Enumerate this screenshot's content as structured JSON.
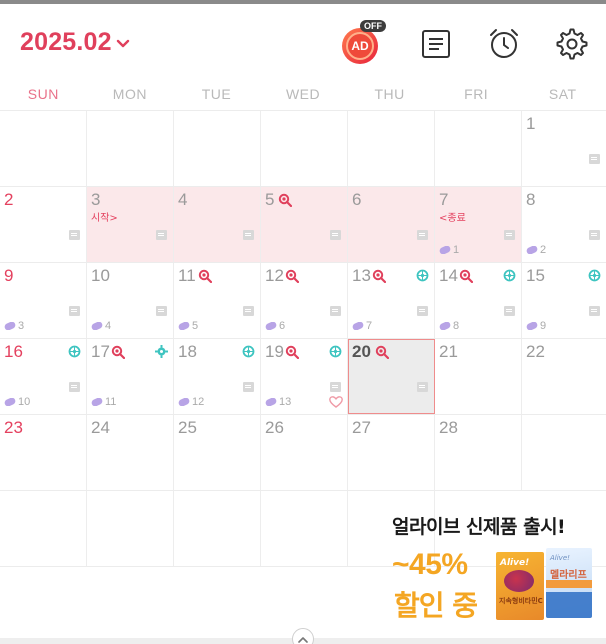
{
  "header": {
    "month": "2025.02",
    "ad_label": "AD",
    "ad_badge": "OFF"
  },
  "weekdays": [
    "SUN",
    "MON",
    "TUE",
    "WED",
    "THU",
    "FRI",
    "SAT"
  ],
  "calendar": {
    "today": "20",
    "period_start_label": "시작>",
    "period_end_label": "<종료",
    "dates": [
      "1",
      "2",
      "3",
      "4",
      "5",
      "6",
      "7",
      "8",
      "9",
      "10",
      "11",
      "12",
      "13",
      "14",
      "15",
      "16",
      "17",
      "18",
      "19",
      "20",
      "21",
      "22",
      "23",
      "24",
      "25",
      "26",
      "27",
      "28"
    ],
    "pill_counts": [
      "1",
      "2",
      "3",
      "4",
      "5",
      "6",
      "7",
      "8",
      "9",
      "10",
      "11",
      "12",
      "13"
    ]
  },
  "ad_banner": {
    "title": "얼라이브 신제품 출시!",
    "discount": "~45%",
    "sale": "할인 중",
    "product1_brand": "Alive!",
    "product1_name": "지속형비타민C",
    "product2_brand": "Alive!",
    "product2_name": "멜라리프"
  },
  "colors": {
    "accent": "#e0405c",
    "range_bg": "#fbe8ea",
    "ad_orange": "#f4a623",
    "cycle_teal": "#3ec4c0"
  }
}
